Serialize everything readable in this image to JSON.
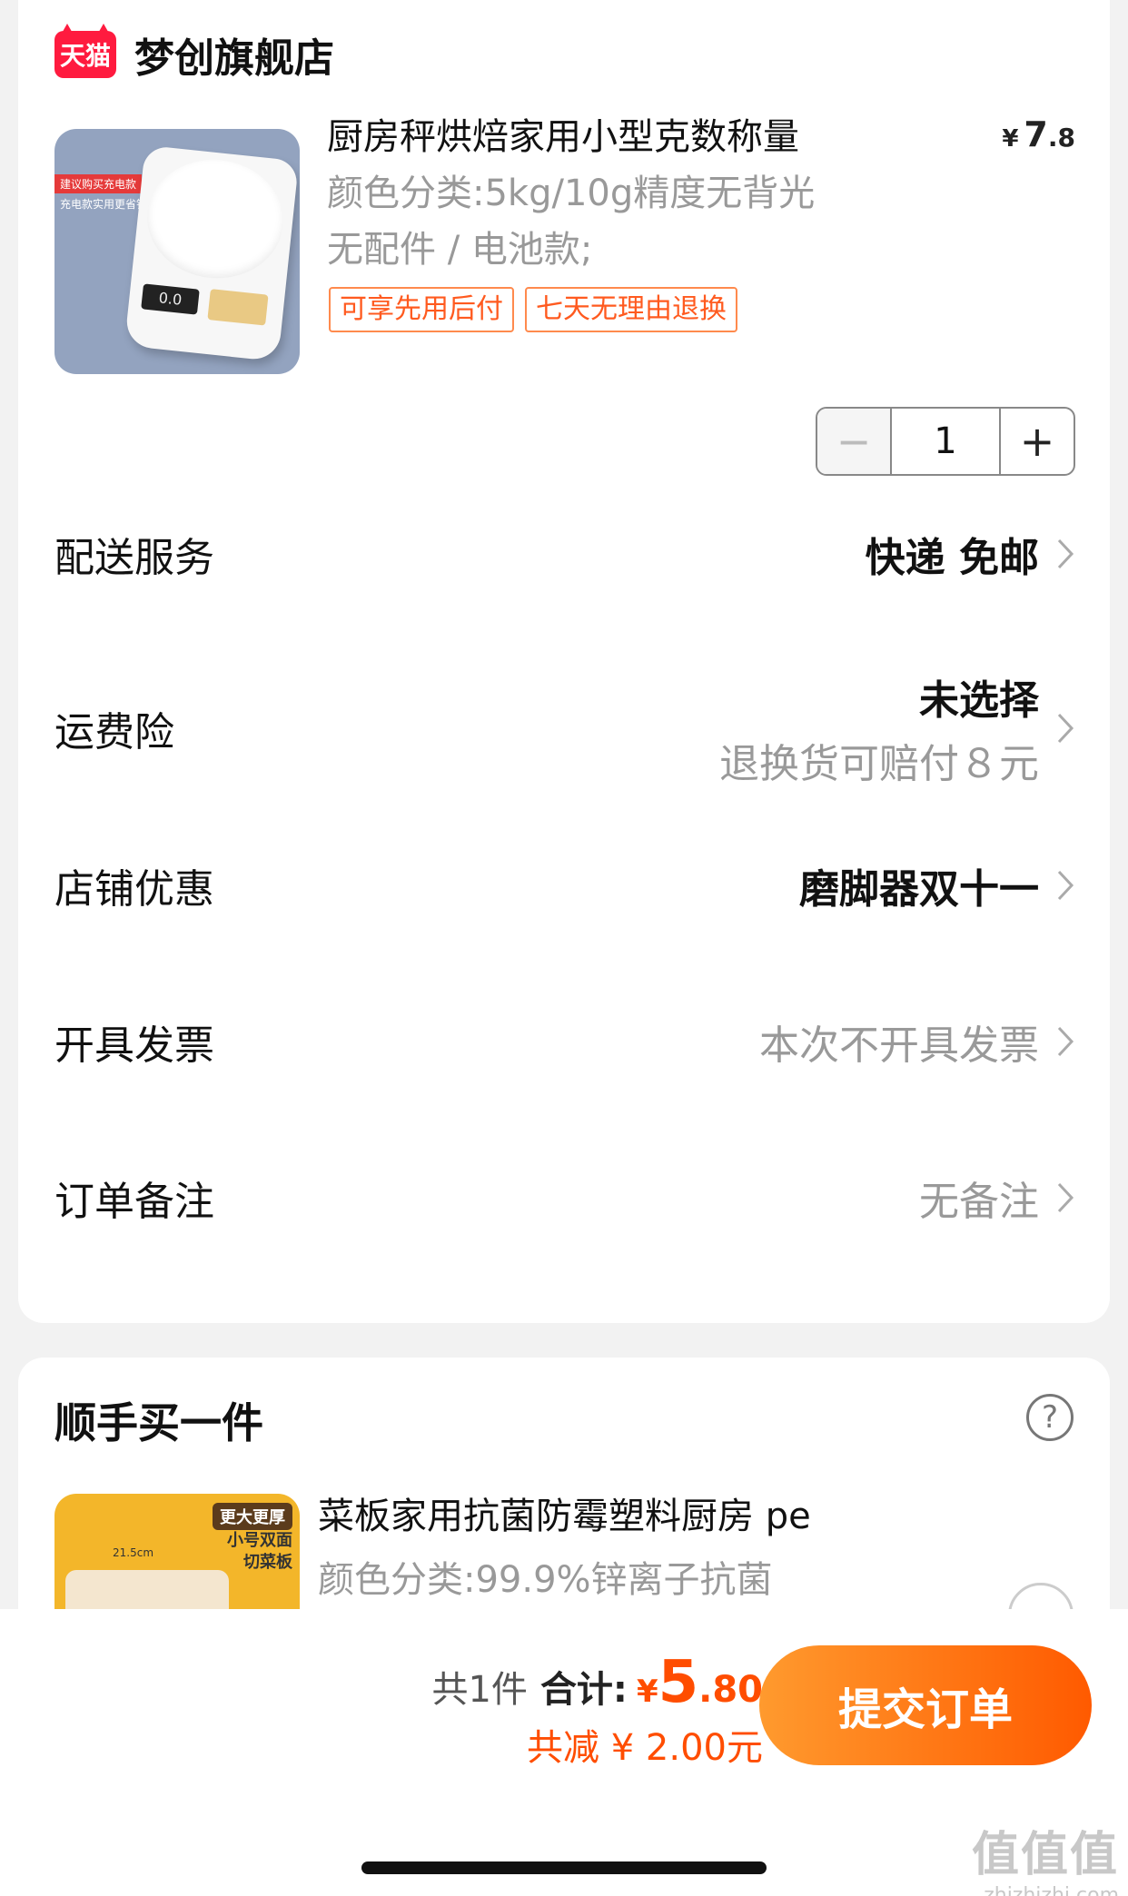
{
  "shop": {
    "badge": "天猫",
    "name": "梦创旗舰店"
  },
  "product": {
    "image_tag_1": "建议购买充电款",
    "image_tag_2": "充电款实用更省钱",
    "display": "0.0",
    "title": "厨房秤烘焙家用小型克数称量",
    "price_symbol": "¥",
    "price_int": "7",
    "price_dec": ".8",
    "spec_line1": "颜色分类:5kg/10g精度无背光",
    "spec_line2": "无配件 / 电池款;",
    "tags": [
      "可享先用后付",
      "七天无理由退换"
    ],
    "quantity": "1",
    "minus": "−",
    "plus": "+"
  },
  "rows": {
    "delivery": {
      "label": "配送服务",
      "value": "快递 免邮"
    },
    "insurance": {
      "label": "运费险",
      "value": "未选择",
      "sub": "退换货可赔付８元"
    },
    "discount": {
      "label": "店铺优惠",
      "value": "磨脚器双十一"
    },
    "invoice": {
      "label": "开具发票",
      "value": "本次不开具发票"
    },
    "note": {
      "label": "订单备注",
      "value": "无备注"
    }
  },
  "addon": {
    "title": "顺手买一件",
    "help": "?",
    "badge": "更大更厚",
    "img_text": "小号双面\n切菜板",
    "dimension": "21.5cm",
    "name": "菜板家用抗菌防霉塑料厨房 pe",
    "spec": "颜色分类:99.9%锌离子抗菌"
  },
  "footer": {
    "count": "共1件",
    "total_label": "合计:",
    "total_symbol": "¥",
    "total_int": "5",
    "total_dec": ".80",
    "discount": "共减 ¥ 2.00元",
    "submit": "提交订单"
  },
  "watermark": {
    "main": "值值值",
    "sub": "zhizhizhi.com"
  },
  "colors": {
    "accent": "#ff4d00",
    "tmall": "#ff1b3f",
    "button_start": "#ff9a2e",
    "button_end": "#ff5a00"
  }
}
